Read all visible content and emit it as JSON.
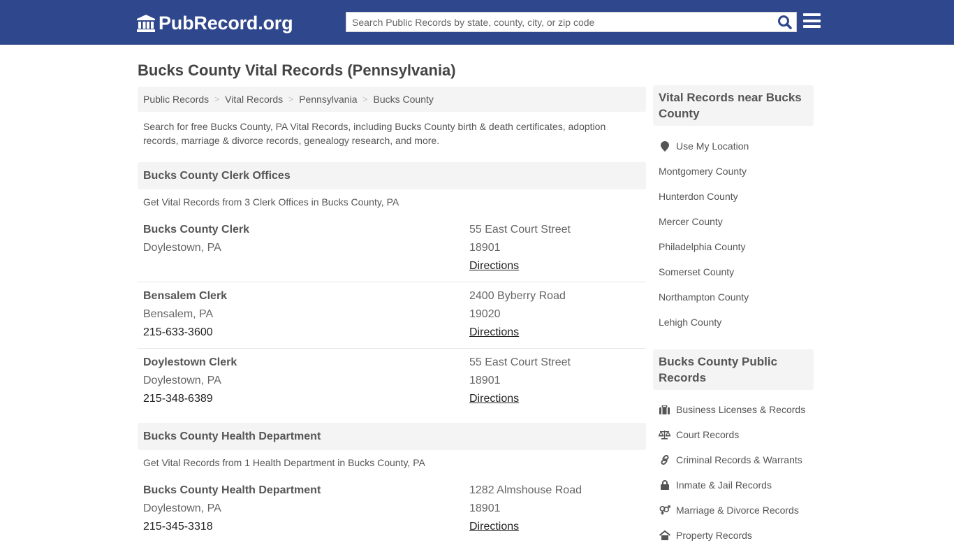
{
  "header": {
    "logo_text": "PubRecord.org",
    "search_placeholder": "Search Public Records by state, county, city, or zip code"
  },
  "page": {
    "title": "Bucks County Vital Records (Pennsylvania)",
    "breadcrumb": [
      "Public Records",
      "Vital Records",
      "Pennsylvania",
      "Bucks County"
    ],
    "intro": "Search for free Bucks County, PA Vital Records, including Bucks County birth & death certificates, adoption records, marriage & divorce records, genealogy research, and more."
  },
  "sections": [
    {
      "title": "Bucks County Clerk Offices",
      "subtitle": "Get Vital Records from 3 Clerk Offices in Bucks County, PA",
      "offices": [
        {
          "name": "Bucks County Clerk",
          "city": "Doylestown, PA",
          "phone": "",
          "address": "55 East Court Street",
          "zip": "18901",
          "directions": "Directions"
        },
        {
          "name": "Bensalem Clerk",
          "city": "Bensalem, PA",
          "phone": "215-633-3600",
          "address": "2400 Byberry Road",
          "zip": "19020",
          "directions": "Directions"
        },
        {
          "name": "Doylestown Clerk",
          "city": "Doylestown, PA",
          "phone": "215-348-6389",
          "address": "55 East Court Street",
          "zip": "18901",
          "directions": "Directions"
        }
      ]
    },
    {
      "title": "Bucks County Health Department",
      "subtitle": "Get Vital Records from 1 Health Department in Bucks County, PA",
      "offices": [
        {
          "name": "Bucks County Health Department",
          "city": "Doylestown, PA",
          "phone": "215-345-3318",
          "address": "1282 Almshouse Road",
          "zip": "18901",
          "directions": "Directions"
        }
      ]
    }
  ],
  "sidebar": {
    "nearby_title": "Vital Records near Bucks County",
    "use_location": "Use My Location",
    "nearby": [
      "Montgomery County",
      "Hunterdon County",
      "Mercer County",
      "Philadelphia County",
      "Somerset County",
      "Northampton County",
      "Lehigh County"
    ],
    "public_title": "Bucks County Public Records",
    "public_links": [
      {
        "label": "Business Licenses & Records",
        "icon": "briefcase-icon"
      },
      {
        "label": "Court Records",
        "icon": "scales-icon"
      },
      {
        "label": "Criminal Records & Warrants",
        "icon": "link-icon"
      },
      {
        "label": "Inmate & Jail Records",
        "icon": "lock-icon"
      },
      {
        "label": "Marriage & Divorce Records",
        "icon": "gender-icon"
      },
      {
        "label": "Property Records",
        "icon": "home-icon"
      }
    ]
  },
  "colors": {
    "brand": "#2f478c",
    "search_icon": "#2f478c",
    "panel": "#f4f4f4"
  }
}
